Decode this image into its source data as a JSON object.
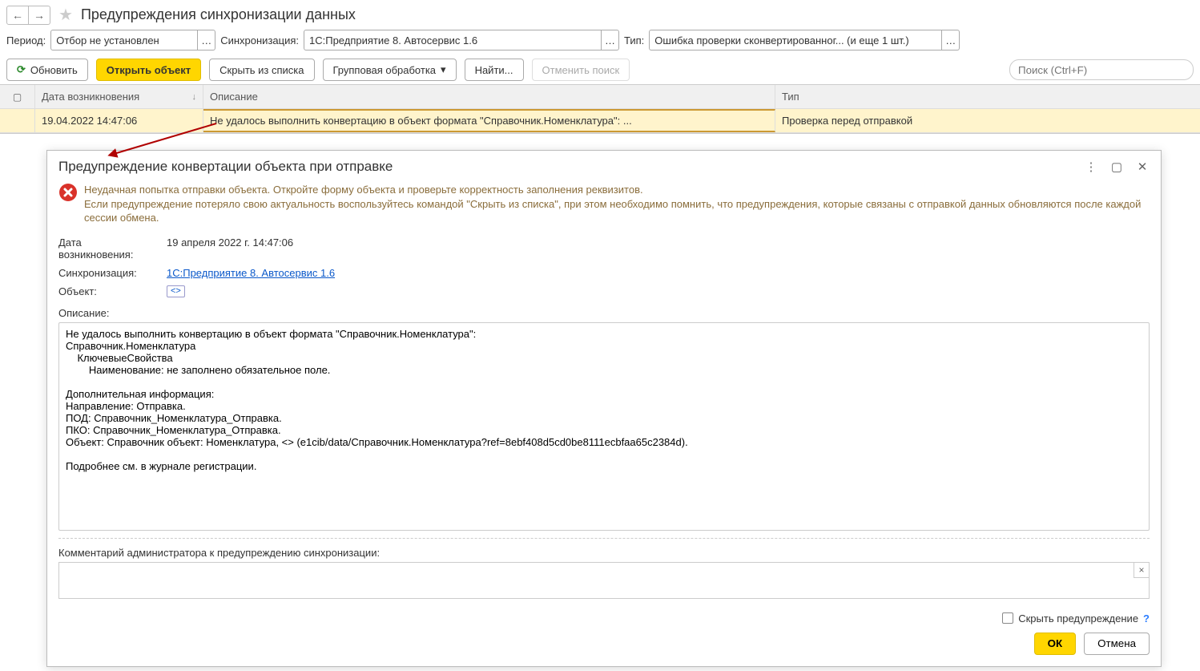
{
  "page": {
    "title": "Предупреждения синхронизации данных"
  },
  "filters": {
    "period_label": "Период:",
    "period_value": "Отбор не установлен",
    "sync_label": "Синхронизация:",
    "sync_value": "1С:Предприятие 8. Автосервис 1.6",
    "type_label": "Тип:",
    "type_value": "Ошибка проверки сконвертированног... (и еще 1 шт.)"
  },
  "commands": {
    "refresh": "Обновить",
    "open_object": "Открыть объект",
    "hide_from_list": "Скрыть из списка",
    "group_process": "Групповая обработка",
    "find": "Найти...",
    "cancel_search": "Отменить поиск",
    "search_placeholder": "Поиск (Ctrl+F)"
  },
  "grid": {
    "col_date": "Дата возникновения",
    "col_desc": "Описание",
    "col_type": "Тип",
    "rows": [
      {
        "date": "19.04.2022 14:47:06",
        "desc": "Не удалось выполнить конвертацию в объект формата \"Справочник.Номенклатура\": ...",
        "type": "Проверка перед отправкой"
      }
    ]
  },
  "dialog": {
    "title": "Предупреждение конвертации объекта при отправке",
    "warning_text": "Неудачная попытка отправки объекта. Откройте форму объекта и проверьте корректность заполнения реквизитов.\nЕсли предупреждение потеряло свою актуальность воспользуйтесь командой \"Скрыть из списка\", при этом необходимо помнить, что предупреждения, которые связаны с отправкой данных обновляются после каждой сессии обмена.",
    "date_label": "Дата возникновения:",
    "date_value": "19 апреля 2022 г. 14:47:06",
    "sync_label": "Синхронизация:",
    "sync_value": "1С:Предприятие 8. Автосервис 1.6",
    "obj_label": "Объект:",
    "obj_placeholder": "<>",
    "desc_label": "Описание:",
    "desc_text": "Не удалось выполнить конвертацию в объект формата \"Справочник.Номенклатура\":\nСправочник.Номенклатура\n    КлючевыеСвойства\n        Наименование: не заполнено обязательное поле.\n\nДополнительная информация:\nНаправление: Отправка.\nПОД: Справочник_Номенклатура_Отправка.\nПКО: Справочник_Номенклатура_Отправка.\nОбъект: Справочник объект: Номенклатура, <> (e1cib/data/Справочник.Номенклатура?ref=8ebf408d5cd0be8111ecbfaa65c2384d).\n\nПодробнее см. в журнале регистрации.",
    "comment_label": "Комментарий администратора к предупреждению синхронизации:",
    "hide_warning_label": "Скрыть предупреждение",
    "ok": "ОК",
    "cancel": "Отмена"
  }
}
